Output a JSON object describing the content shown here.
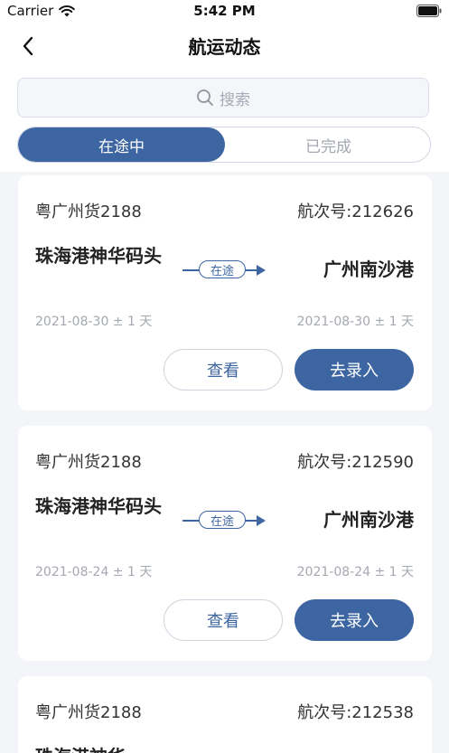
{
  "status_bar": {
    "carrier": "Carrier",
    "time": "5:42 PM"
  },
  "nav": {
    "title": "航运动态"
  },
  "search": {
    "placeholder": "搜索"
  },
  "tabs": [
    {
      "label": "在途中",
      "active": true
    },
    {
      "label": "已完成",
      "active": false
    }
  ],
  "cards": [
    {
      "vessel": "粤广州货2188",
      "voyage": "航次号:212626",
      "origin": "珠海港神华码头",
      "destination": "广州南沙港",
      "status": "在途",
      "origin_date": "2021-08-30 ± 1 天",
      "dest_date": "2021-08-30 ± 1 天",
      "view_label": "查看",
      "enter_label": "去录入"
    },
    {
      "vessel": "粤广州货2188",
      "voyage": "航次号:212590",
      "origin": "珠海港神华码头",
      "destination": "广州南沙港",
      "status": "在途",
      "origin_date": "2021-08-24 ± 1 天",
      "dest_date": "2021-08-24 ± 1 天",
      "view_label": "查看",
      "enter_label": "去录入"
    },
    {
      "vessel": "粤广州货2188",
      "voyage": "航次号:212538",
      "origin": "珠海港神华"
    }
  ],
  "colors": {
    "primary": "#3d65a1",
    "page_bg": "#f3f5f9",
    "muted_text": "#a4a8b0"
  },
  "icons": {
    "back": "chevron-left-icon",
    "search": "search-icon",
    "wifi": "wifi-icon",
    "battery": "battery-icon"
  }
}
